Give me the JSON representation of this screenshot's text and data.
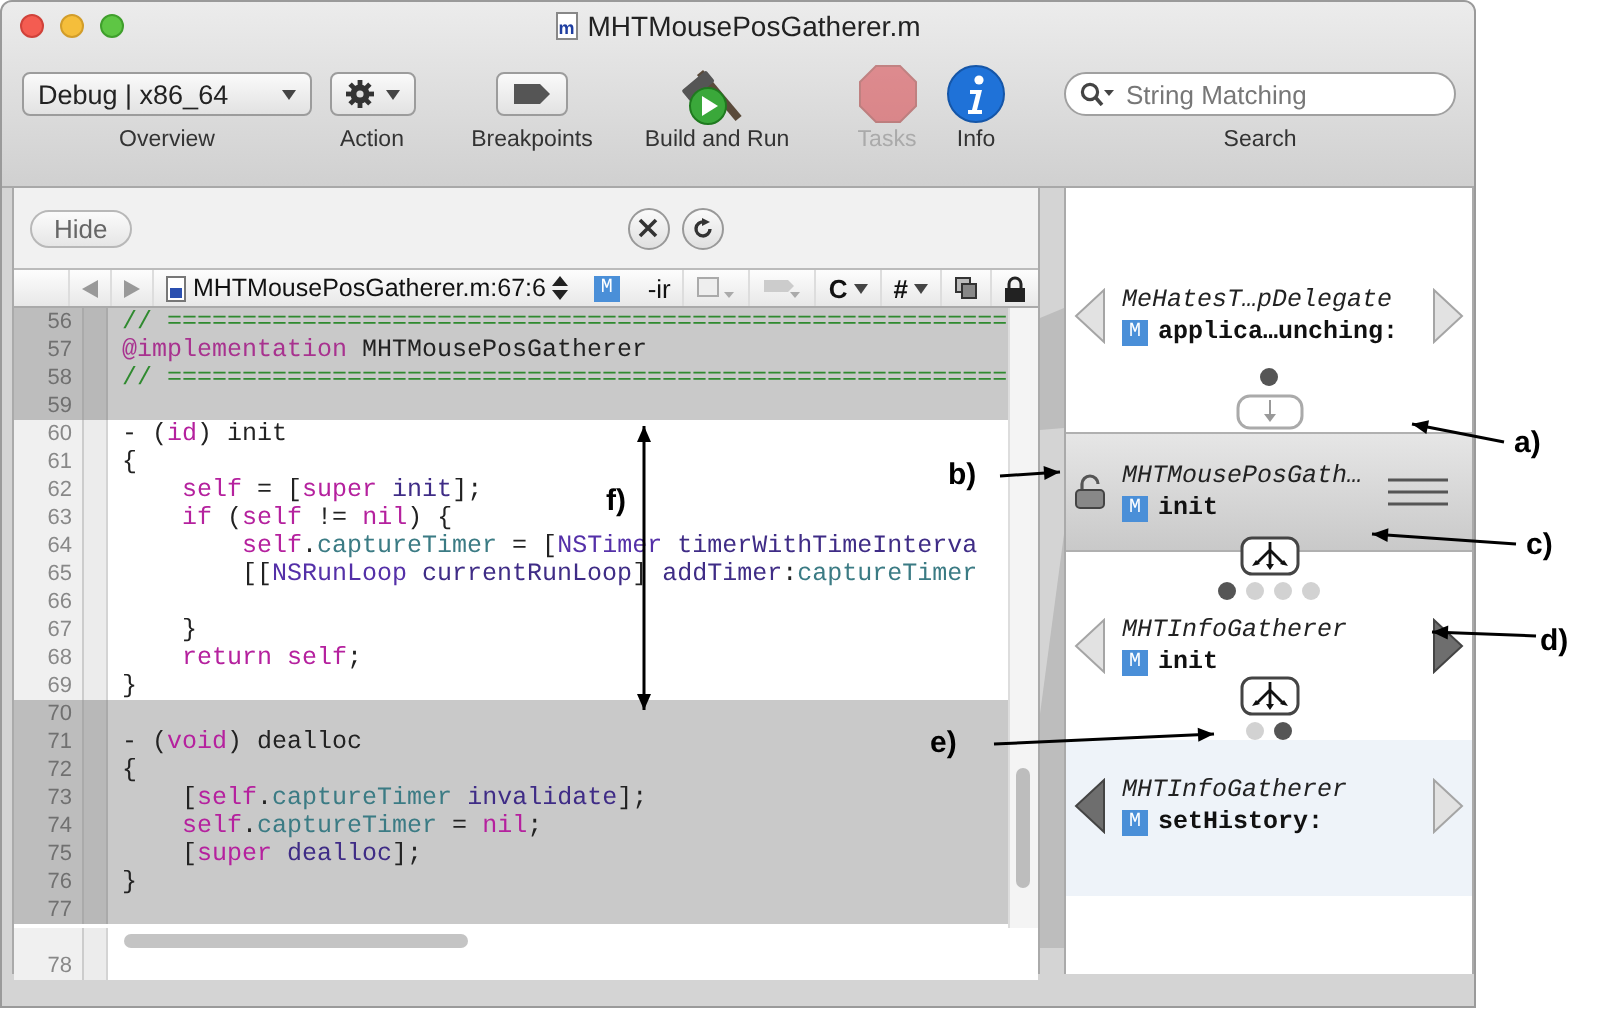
{
  "window": {
    "title": "MHTMousePosGatherer.m",
    "file_badge": "m"
  },
  "toolbar": [
    {
      "kind": "popup",
      "label": "Overview",
      "value": "Debug | x86_64",
      "disabled": false
    },
    {
      "kind": "action",
      "label": "Action",
      "disabled": false
    },
    {
      "kind": "breakpoints",
      "label": "Breakpoints",
      "disabled": false
    },
    {
      "kind": "build",
      "label": "Build and Run",
      "disabled": false
    },
    {
      "kind": "tasks",
      "label": "Tasks",
      "disabled": true
    },
    {
      "kind": "info",
      "label": "Info",
      "disabled": false
    },
    {
      "kind": "search",
      "label": "Search",
      "placeholder": "String Matching",
      "disabled": false
    }
  ],
  "editor": {
    "hide_button": "Hide",
    "jump_bar": {
      "path": "MHTMousePosGatherer.m:67:6",
      "badge": "M",
      "symbol": "-ir",
      "menus": [
        "C",
        "#"
      ]
    },
    "lines": [
      {
        "number": "56",
        "dimmed": true,
        "tokens": [
          {
            "text": "// ========================================================",
            "kind": "comment"
          }
        ]
      },
      {
        "number": "57",
        "dimmed": true,
        "tokens": [
          {
            "text": "@implementation",
            "kind": "directive"
          },
          {
            "text": " MHTMousePosGatherer",
            "kind": "plain"
          }
        ]
      },
      {
        "number": "58",
        "dimmed": true,
        "tokens": [
          {
            "text": "// ========================================================",
            "kind": "comment"
          }
        ]
      },
      {
        "number": "59",
        "dimmed": true
      },
      {
        "number": "60",
        "dimmed": false,
        "tokens": [
          {
            "text": "- (",
            "kind": "plain"
          },
          {
            "text": "id",
            "kind": "keyword"
          },
          {
            "text": ") init",
            "kind": "plain"
          }
        ]
      },
      {
        "number": "61",
        "dimmed": false,
        "tokens": [
          {
            "text": "{",
            "kind": "plain"
          }
        ]
      },
      {
        "number": "62",
        "dimmed": false,
        "tokens": [
          {
            "text": "    self",
            "kind": "keyword"
          },
          {
            "text": " = [",
            "kind": "plain"
          },
          {
            "text": "super",
            "kind": "keyword"
          },
          {
            "text": " init",
            "kind": "method"
          },
          {
            "text": "];",
            "kind": "plain"
          }
        ]
      },
      {
        "number": "63",
        "dimmed": false,
        "tokens": [
          {
            "text": "    if",
            "kind": "keyword"
          },
          {
            "text": " (",
            "kind": "plain"
          },
          {
            "text": "self",
            "kind": "keyword"
          },
          {
            "text": " != ",
            "kind": "plain"
          },
          {
            "text": "nil",
            "kind": "keyword"
          },
          {
            "text": ") {",
            "kind": "plain"
          }
        ]
      },
      {
        "number": "64",
        "dimmed": false,
        "tokens": [
          {
            "text": "        self",
            "kind": "keyword"
          },
          {
            "text": ".",
            "kind": "plain"
          },
          {
            "text": "captureTimer",
            "kind": "property"
          },
          {
            "text": " = [",
            "kind": "plain"
          },
          {
            "text": "NSTimer",
            "kind": "class"
          },
          {
            "text": " timerWithTimeInterva",
            "kind": "method"
          }
        ]
      },
      {
        "number": "65",
        "dimmed": false,
        "tokens": [
          {
            "text": "        [[",
            "kind": "plain"
          },
          {
            "text": "NSRunLoop",
            "kind": "class"
          },
          {
            "text": " currentRunLoop",
            "kind": "method"
          },
          {
            "text": "] ",
            "kind": "plain"
          },
          {
            "text": "addTimer",
            "kind": "method"
          },
          {
            "text": ":",
            "kind": "plain"
          },
          {
            "text": "captureTimer",
            "kind": "property"
          }
        ]
      },
      {
        "number": "66",
        "dimmed": false
      },
      {
        "number": "67",
        "dimmed": false,
        "tokens": [
          {
            "text": "    }",
            "kind": "plain"
          }
        ]
      },
      {
        "number": "68",
        "dimmed": false,
        "tokens": [
          {
            "text": "    return self",
            "kind": "keyword"
          },
          {
            "text": ";",
            "kind": "plain"
          }
        ]
      },
      {
        "number": "69",
        "dimmed": false,
        "tokens": [
          {
            "text": "}",
            "kind": "plain"
          }
        ]
      },
      {
        "number": "70",
        "dimmed": true
      },
      {
        "number": "71",
        "dimmed": true,
        "tokens": [
          {
            "text": "- (",
            "kind": "plain"
          },
          {
            "text": "void",
            "kind": "keyword"
          },
          {
            "text": ") dealloc",
            "kind": "plain"
          }
        ]
      },
      {
        "number": "72",
        "dimmed": true,
        "tokens": [
          {
            "text": "{",
            "kind": "plain"
          }
        ]
      },
      {
        "number": "73",
        "dimmed": true,
        "tokens": [
          {
            "text": "    [",
            "kind": "plain"
          },
          {
            "text": "self",
            "kind": "keyword"
          },
          {
            "text": ".",
            "kind": "plain"
          },
          {
            "text": "captureTimer",
            "kind": "property"
          },
          {
            "text": " invalidate",
            "kind": "method"
          },
          {
            "text": "];",
            "kind": "plain"
          }
        ]
      },
      {
        "number": "74",
        "dimmed": true,
        "tokens": [
          {
            "text": "    self",
            "kind": "keyword"
          },
          {
            "text": ".",
            "kind": "plain"
          },
          {
            "text": "captureTimer",
            "kind": "property"
          },
          {
            "text": " = ",
            "kind": "plain"
          },
          {
            "text": "nil",
            "kind": "keyword"
          },
          {
            "text": ";",
            "kind": "plain"
          }
        ]
      },
      {
        "number": "75",
        "dimmed": true,
        "tokens": [
          {
            "text": "    [",
            "kind": "plain"
          },
          {
            "text": "super",
            "kind": "keyword"
          },
          {
            "text": " dealloc",
            "kind": "method"
          },
          {
            "text": "];",
            "kind": "plain"
          }
        ]
      },
      {
        "number": "76",
        "dimmed": true,
        "tokens": [
          {
            "text": "}",
            "kind": "plain"
          }
        ]
      },
      {
        "number": "77",
        "dimmed": true
      }
    ],
    "after_scroll_lines": [
      {
        "number": "78"
      }
    ]
  },
  "stack": [
    {
      "class": "MeHatesT…pDelegate",
      "badge": "M",
      "method": "applica…unching:",
      "selected": false,
      "highlighted": false,
      "back_active": false,
      "forward_active": false,
      "link": {
        "kind": "single",
        "dots": [
          {
            "selected": true
          }
        ]
      }
    },
    {
      "class": "MHTMousePosGath…",
      "badge": "M",
      "method": "init",
      "selected": true,
      "highlighted": false,
      "link": {
        "kind": "fork",
        "dots": [
          {
            "selected": true
          },
          {
            "selected": false
          },
          {
            "selected": false
          },
          {
            "selected": false
          }
        ]
      }
    },
    {
      "class": "MHTInfoGatherer",
      "badge": "M",
      "method": "init",
      "selected": false,
      "highlighted": false,
      "back_active": false,
      "forward_active": true,
      "link": {
        "kind": "fork",
        "dots": [
          {
            "selected": false
          },
          {
            "selected": true
          }
        ]
      }
    },
    {
      "class": "MHTInfoGatherer",
      "badge": "M",
      "method": "setHistory:",
      "selected": false,
      "highlighted": true,
      "back_active": true,
      "forward_active": false
    }
  ],
  "annotations": [
    {
      "label": "a)"
    },
    {
      "label": "b)"
    },
    {
      "label": "c)"
    },
    {
      "label": "d)"
    },
    {
      "label": "e)"
    },
    {
      "label": "f)"
    }
  ]
}
